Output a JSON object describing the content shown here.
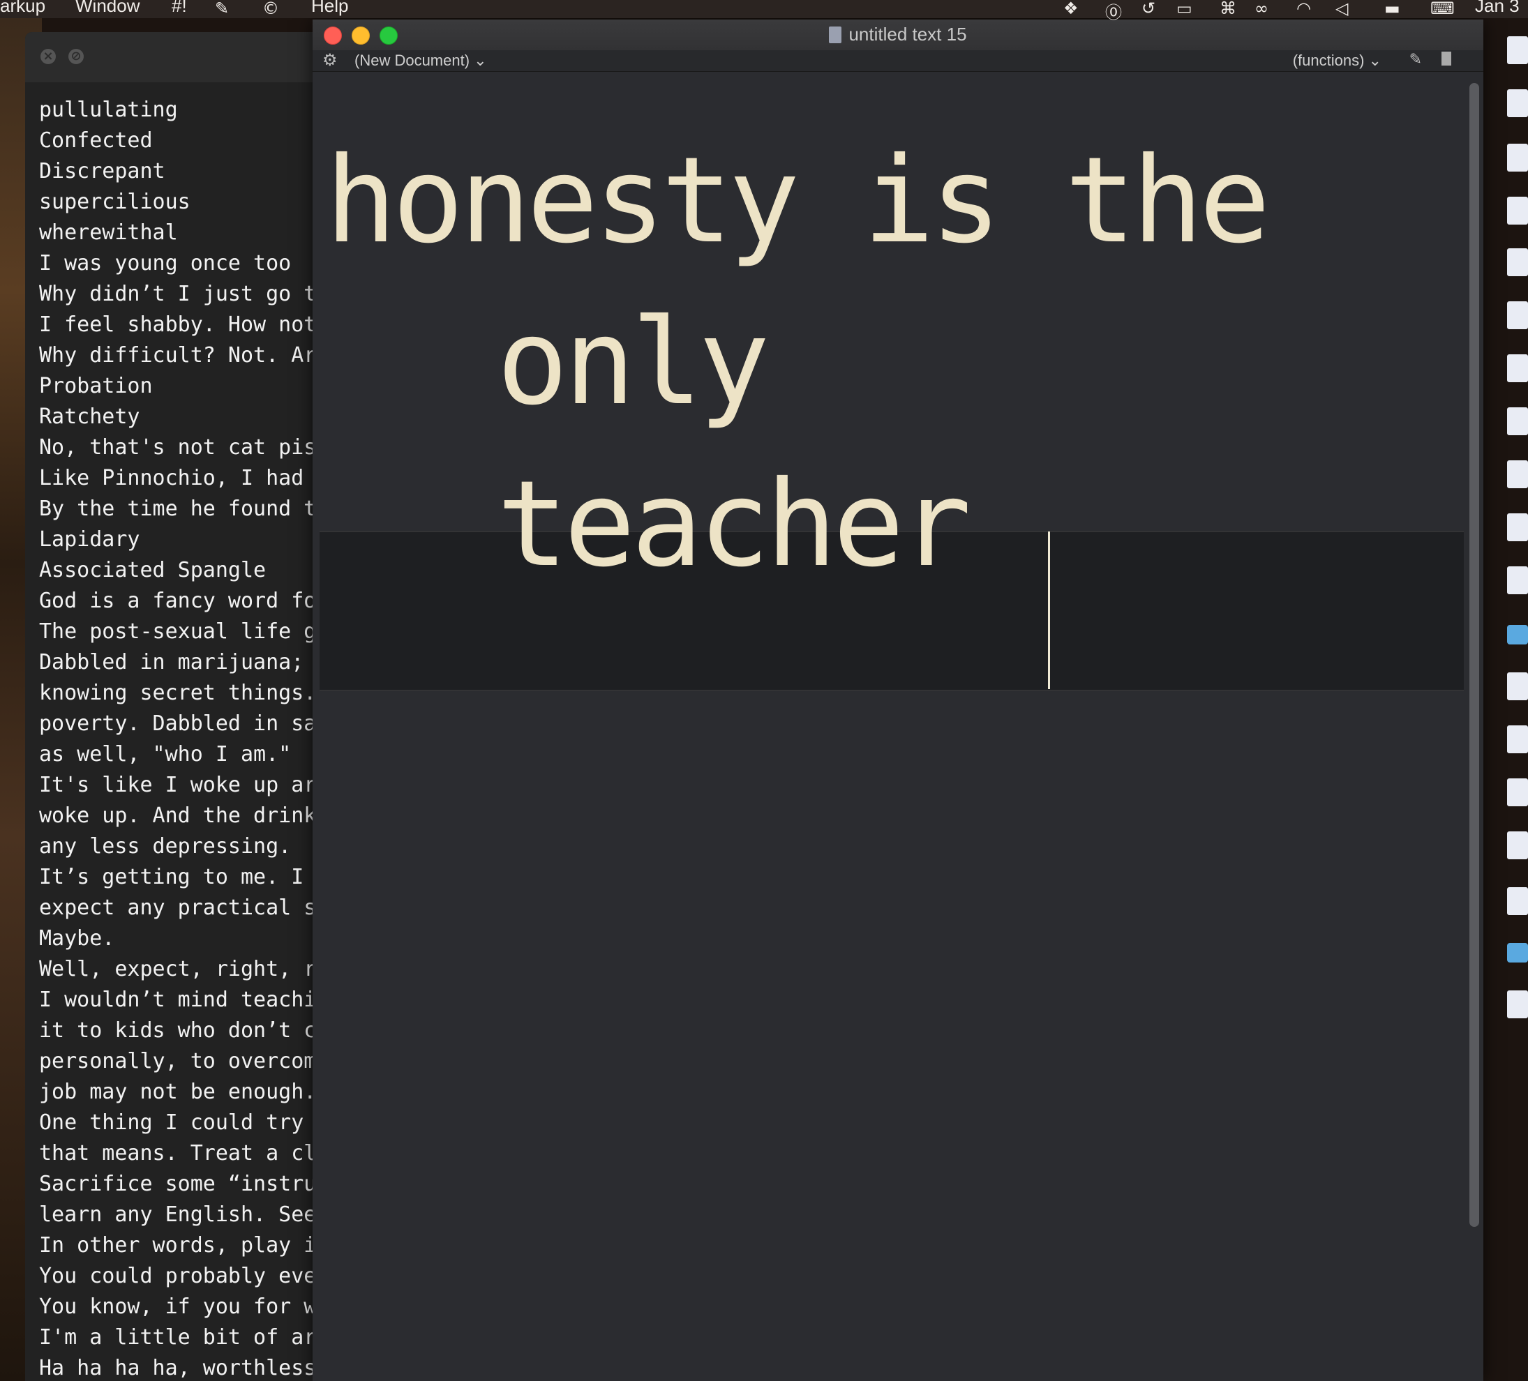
{
  "menubar": {
    "items": [
      "arkup",
      "Window",
      "#!",
      "Help"
    ],
    "right_icons": [
      "dropbox-icon",
      "onepassword-icon",
      "time-machine-icon",
      "display-icon",
      "command-icon",
      "glasses-icon",
      "wifi-icon",
      "volume-icon",
      "battery-icon",
      "keyboard-icon"
    ],
    "clock": "Jan 3"
  },
  "back_window": {
    "lines": [
      "pullulating",
      "Confected",
      "Discrepant",
      "supercilious",
      "wherewithal",
      "I was young once too",
      "Why didn’t I just go t",
      "I feel shabby. How not",
      "Why difficult? Not. Ar",
      "Probation",
      "Ratchety",
      "No, that's not cat pis",
      "Like Pinnochio, I had",
      "By the time he found t",
      "Lapidary",
      "Associated Spangle",
      "God is a fancy word fo",
      "The post-sexual life g",
      "Dabbled in marijuana;",
      "knowing secret things.",
      "poverty. Dabbled in sa",
      "as well, \"who I am.\"",
      "It's like I woke up ar",
      "woke up. And the drink",
      "any less depressing.",
      "It’s getting to me. I",
      "expect any practical s",
      "Maybe.",
      "Well, expect, right, r",
      "I wouldn’t mind teachi",
      "it to kids who don’t c",
      "personally, to overcom",
      "job may not be enough.",
      "One thing I could try",
      "that means. Treat a cl",
      "Sacrifice some “instru",
      "learn any English. See",
      "In other words, play i",
      "You could probably eve",
      "You know, if you for w",
      "I'm a little bit of ar",
      "Ha ha ha ha, worthless"
    ]
  },
  "main_window": {
    "title": "untitled text 15",
    "navbar": {
      "document_menu": "(New Document) ⌄",
      "functions_menu": "(functions) ⌄"
    },
    "editor_lines": [
      "honesty is the",
      "only",
      "teacher"
    ]
  }
}
